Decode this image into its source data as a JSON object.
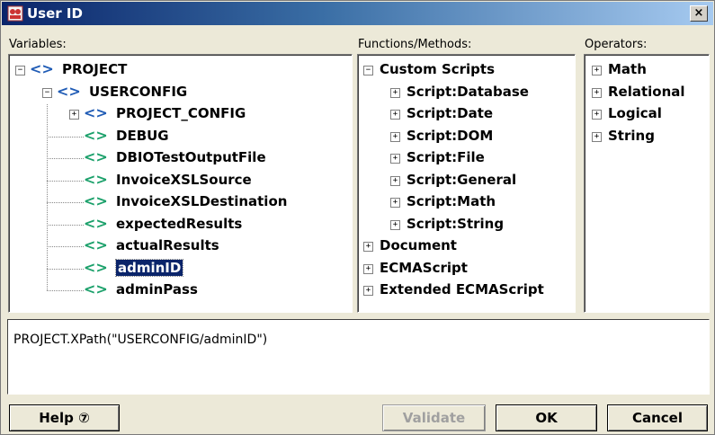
{
  "window": {
    "title": "User ID",
    "close_glyph": "×"
  },
  "labels": {
    "variables": "Variables:",
    "functions": "Functions/Methods:",
    "operators": "Operators:"
  },
  "variables_tree": [
    {
      "label": "PROJECT",
      "icon": "variable-icon",
      "expander": "-"
    },
    {
      "label": "USERCONFIG",
      "icon": "variable-icon",
      "expander": "-"
    },
    {
      "label": "PROJECT_CONFIG",
      "icon": "variable-icon",
      "expander": "+"
    },
    {
      "label": "DEBUG",
      "icon": "variable-icon"
    },
    {
      "label": "DBIOTestOutputFile",
      "icon": "variable-icon"
    },
    {
      "label": "InvoiceXSLSource",
      "icon": "variable-icon"
    },
    {
      "label": "InvoiceXSLDestination",
      "icon": "variable-icon"
    },
    {
      "label": "expectedResults",
      "icon": "variable-icon"
    },
    {
      "label": "actualResults",
      "icon": "variable-icon"
    },
    {
      "label": "adminID",
      "icon": "variable-icon",
      "selected": true
    },
    {
      "label": "adminPass",
      "icon": "variable-icon"
    }
  ],
  "variable_glyph": "<>",
  "functions_tree": [
    {
      "label": "Custom Scripts",
      "expander": "-"
    },
    {
      "label": "Script:Database",
      "expander": "+"
    },
    {
      "label": "Script:Date",
      "expander": "+"
    },
    {
      "label": "Script:DOM",
      "expander": "+"
    },
    {
      "label": "Script:File",
      "expander": "+"
    },
    {
      "label": "Script:General",
      "expander": "+"
    },
    {
      "label": "Script:Math",
      "expander": "+"
    },
    {
      "label": "Script:String",
      "expander": "+"
    },
    {
      "label": "Document",
      "expander": "+"
    },
    {
      "label": "ECMAScript",
      "expander": "+"
    },
    {
      "label": "Extended ECMAScript",
      "expander": "+"
    }
  ],
  "operators_tree": [
    {
      "label": "Math",
      "expander": "+"
    },
    {
      "label": "Relational",
      "expander": "+"
    },
    {
      "label": "Logical",
      "expander": "+"
    },
    {
      "label": "String",
      "expander": "+"
    }
  ],
  "expression": {
    "value": "PROJECT.XPath(\"USERCONFIG/adminID\")"
  },
  "buttons": {
    "help": "Help ⑦",
    "validate": "Validate",
    "ok": "OK",
    "cancel": "Cancel"
  },
  "colors": {
    "selection": "#0a246a",
    "variable_blue": "#1f5bb5",
    "variable_green": "#1aa06a"
  }
}
